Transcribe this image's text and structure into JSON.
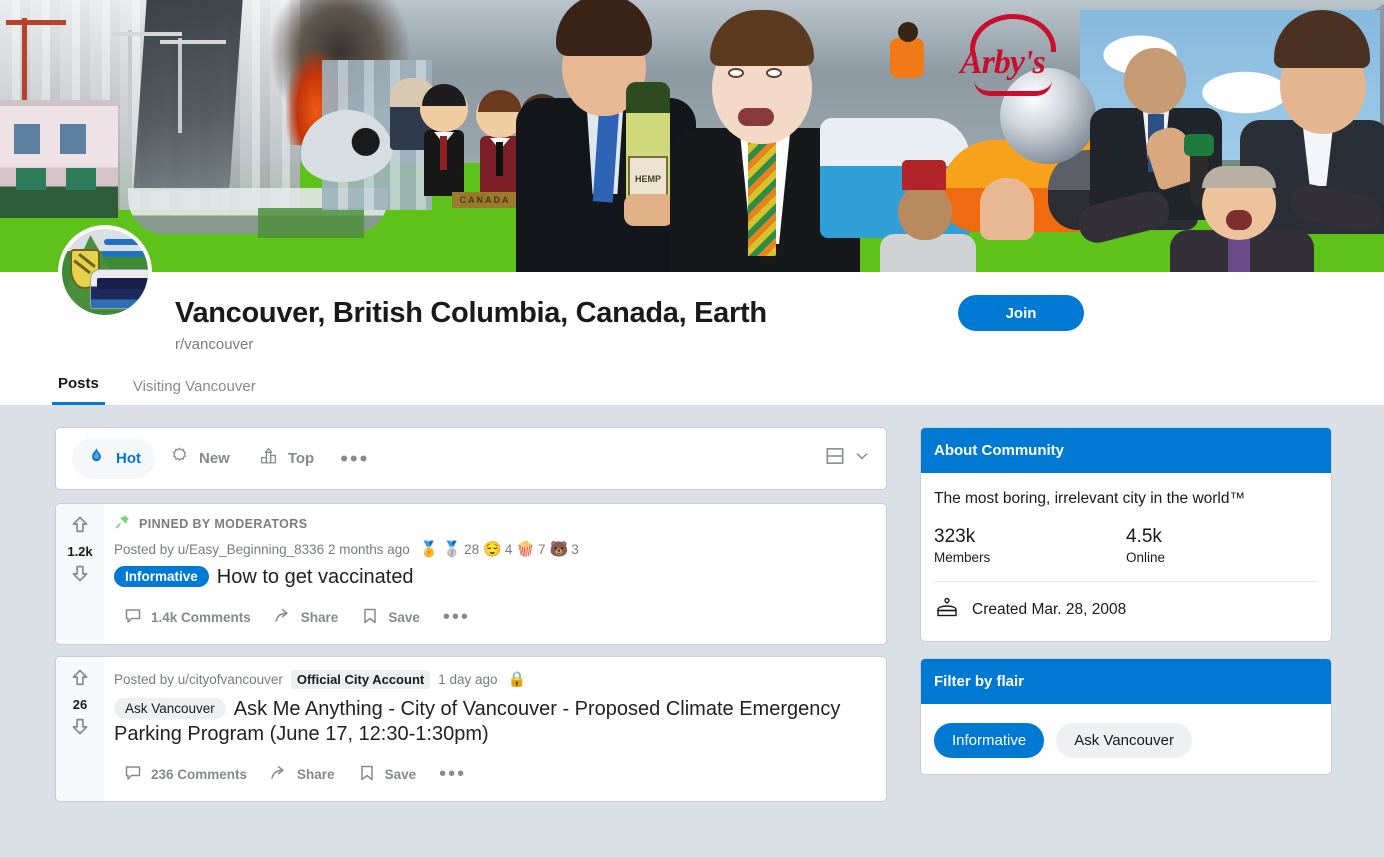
{
  "community": {
    "title": "Vancouver, British Columbia, Canada, Earth",
    "handle": "r/vancouver",
    "join_label": "Join",
    "banner_alt": "community-banner-collage",
    "tabs": [
      {
        "label": "Posts",
        "active": true
      },
      {
        "label": "Visiting Vancouver",
        "active": false
      }
    ]
  },
  "sortbar": {
    "items": [
      {
        "label": "Hot",
        "icon": "flame-icon",
        "active": true
      },
      {
        "label": "New",
        "icon": "sparkle-icon",
        "active": false
      },
      {
        "label": "Top",
        "icon": "podium-icon",
        "active": false
      }
    ],
    "more_label": "•••",
    "view_mode_icon": "card-view-icon",
    "view_chevron_icon": "chevron-down-icon"
  },
  "posts": [
    {
      "score": "1.2k",
      "pinned_label": "PINNED BY MODERATORS",
      "pinned": true,
      "posted_by": "Posted by u/Easy_Beginning_8336",
      "time": "2 months ago",
      "awards": [
        {
          "icon": "🏅",
          "name": "gold-award-icon",
          "count": ""
        },
        {
          "icon": "🥈",
          "name": "silver-award-icon",
          "count": "28"
        },
        {
          "icon": "😌",
          "name": "wholesome-award-icon",
          "count": "4"
        },
        {
          "icon": "🍿",
          "name": "silver-s-award-icon",
          "count": "7"
        },
        {
          "icon": "🐻",
          "name": "bear-award-icon",
          "count": "3"
        }
      ],
      "flair": {
        "label": "Informative",
        "style": "blue"
      },
      "title": "How to get vaccinated",
      "comments": "1.4k Comments",
      "share": "Share",
      "save": "Save"
    },
    {
      "score": "26",
      "pinned": false,
      "posted_by": "Posted by u/cityofvancouver",
      "user_badge": "Official City Account",
      "time": "1 day ago",
      "lock_icon": "🔒",
      "awards": [],
      "flair": {
        "label": "Ask Vancouver",
        "style": "grey"
      },
      "title": "Ask Me Anything - City of Vancouver - Proposed Climate Emergency Parking Program (June 17, 12:30-1:30pm)",
      "comments": "236 Comments",
      "share": "Share",
      "save": "Save"
    }
  ],
  "sidebar": {
    "about": {
      "heading": "About Community",
      "description": "The most boring, irrelevant city in the world™",
      "members_count": "323k",
      "members_label": "Members",
      "online_count": "4.5k",
      "online_label": "Online",
      "created": "Created Mar. 28, 2008",
      "created_icon": "cake-icon"
    },
    "flair_filter": {
      "heading": "Filter by flair",
      "options": [
        {
          "label": "Informative",
          "selected": true
        },
        {
          "label": "Ask Vancouver",
          "selected": false
        }
      ]
    }
  },
  "colors": {
    "accent": "#0079d3",
    "page_bg": "#dae0e6",
    "card_bg": "#ffffff",
    "muted_text": "#787c7e",
    "title_text": "#1a1a1b"
  }
}
